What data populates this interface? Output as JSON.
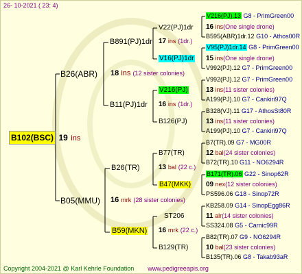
{
  "header": {
    "date": "26- 10-2021 ( 23:  4)"
  },
  "footer": {
    "copyright": "Copyright 2004-2021 @ Karl Kehrle Foundation",
    "url": "www.pedigreeapis.org"
  },
  "root": {
    "label": "B102(BSC)",
    "num": "19",
    "ins": "ins"
  },
  "gen1": [
    {
      "label": "B26(ABR)"
    },
    {
      "label": "B05(MMU)"
    }
  ],
  "gen2": [
    {
      "label": "B891(PJ)1dr",
      "num": "18",
      "ins": "ins",
      "sis": "(12 sister colonies)"
    },
    {
      "label": "B11(PJ)1dr",
      "num": "16",
      "ins": "ins",
      "sis": "(1dr.)"
    },
    {
      "label": "B26(TR)",
      "num": "13",
      "ins": "bal",
      "sis": "(22 c.)"
    },
    {
      "label": "B59(MKN)",
      "num": "16",
      "ins": "mrk",
      "sis": "(28 sister colonies)"
    }
  ],
  "gen3": [
    {
      "label": "V22(PJ)1dr",
      "num": "17",
      "ins": "ins",
      "sis": "(1dr.)"
    },
    {
      "label": "V16(PJ)1dr",
      "num": "",
      "ins": "",
      "sis": ""
    },
    {
      "label": "V216(PJ)",
      "num": "13",
      "ins": "ins",
      "sis": "(11 sister colonies)"
    },
    {
      "label": "B126(PJ)",
      "num": "13",
      "ins": "ins",
      "sis": "(11 sister colonies)"
    },
    {
      "label": "B77(TR)",
      "num": "12",
      "ins": "bal",
      "sis": "(24 sister colonies)"
    },
    {
      "label": "B47(MKK)",
      "num": "09",
      "ins": "nex",
      "sis": "(12 sister colonies)"
    },
    {
      "label": "ST206",
      "num": "11",
      "ins": "alr",
      "sis": "(14 sister colonies)"
    },
    {
      "label": "B129(TR)",
      "num": "10",
      "ins": "bal",
      "sis": "(23 sister colonies)"
    }
  ],
  "gen4": [
    {
      "a": "V216(PJ).13",
      "b": "G8 - PrimGreen00"
    },
    {
      "num": "16",
      "ins": "ins",
      "sis": "(One single drone)"
    },
    {
      "a": "B595(ABR)1dr.12",
      "b": "G10 - Athos00R"
    },
    {
      "a": "V95(PJ)1dr.14",
      "b": "G8 - PrimGreen00"
    },
    {
      "num": "15",
      "ins": "ins",
      "sis": "(One single drone)"
    },
    {
      "a": "V992(PJ).12",
      "b": "G7 - PrimGreen00"
    },
    {
      "a": "V992(PJ).12",
      "b": "G7 - PrimGreen00"
    },
    {
      "num": "13",
      "ins": "ins",
      "sis": "(11 sister colonies)"
    },
    {
      "a": "A199(PJ).10",
      "b": "G7 - Cankiri97Q"
    },
    {
      "a": "B328(VJ).11",
      "b": "G17 - AthosSt80R"
    },
    {
      "num": "13",
      "ins": "ins",
      "sis": "(11 sister colonies)"
    },
    {
      "a": "A199(PJ).10",
      "b": "G7 - Cankiri97Q"
    },
    {
      "a": "B7(TR).09",
      "b": "G7 - MG00R"
    },
    {
      "num": "12",
      "ins": "bal",
      "sis": "(24 sister colonies)"
    },
    {
      "a": "B72(TR).10",
      "b": "G11 - NO6294R"
    },
    {
      "a": "B171(TR).06",
      "b": "G22 - Sinop62R"
    },
    {
      "num": "09",
      "ins": "nex",
      "sis": "(12 sister colonies)"
    },
    {
      "a": "PS596.06",
      "b": "G18 - Sinop72R"
    },
    {
      "a": "KB258.09",
      "b": "G14 - SinopEgg86R"
    },
    {
      "num": "11",
      "ins": "alr",
      "sis": "(14 sister colonies)"
    },
    {
      "a": "SS324.08",
      "b": "G5 - Carnic99R"
    },
    {
      "a": "B82(TR).07",
      "b": "G9 - NO6294R"
    },
    {
      "num": "10",
      "ins": "bal",
      "sis": "(23 sister colonies)"
    },
    {
      "a": "B135(TR).06",
      "b": "G8 - Takab93aR"
    }
  ],
  "colors": {
    "background": "#ffffe0",
    "highlight_root": "#ffff00",
    "highlight_green": "#00ff00",
    "highlight_cyan": "#00ffff"
  }
}
